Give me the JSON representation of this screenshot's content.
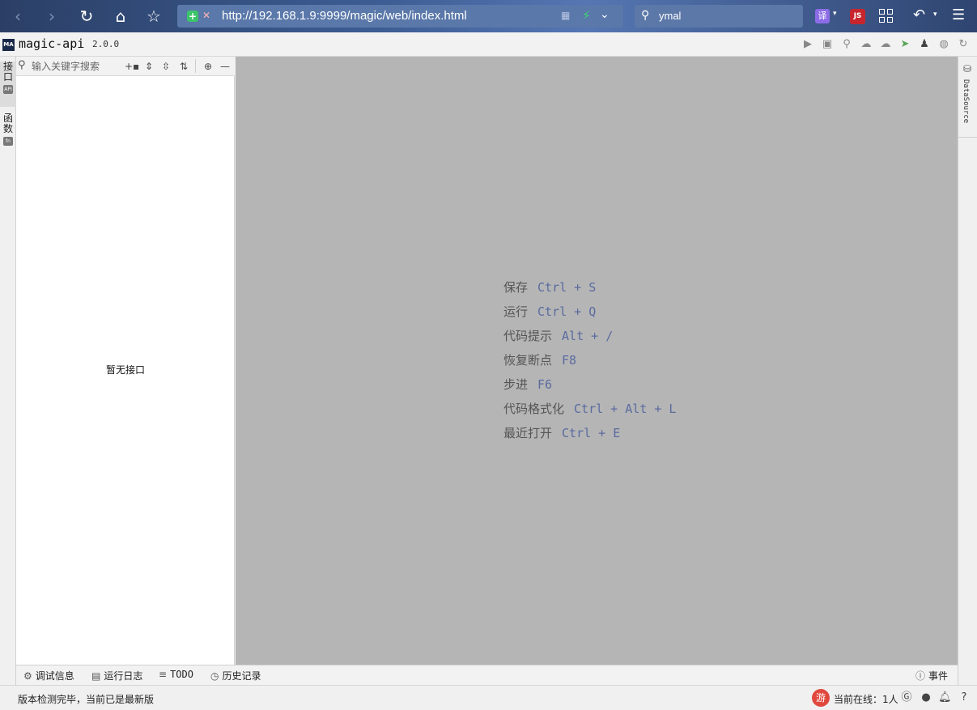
{
  "browser": {
    "url": "http://192.168.1.9:9999/magic/web/index.html",
    "search_text": "ymal",
    "translate_ext_label": "译",
    "js_ext_label": "JS"
  },
  "app": {
    "logo_text": "MA",
    "name": "magic-api",
    "version": "2.0.0"
  },
  "left_tabs": [
    {
      "label": "接口",
      "badge": "API"
    },
    {
      "label": "函数",
      "badge": "fn"
    }
  ],
  "sidebar": {
    "search_placeholder": "输入关键字搜索",
    "empty_text": "暂无接口"
  },
  "shortcuts": [
    {
      "label": "保存",
      "keys": "Ctrl + S"
    },
    {
      "label": "运行",
      "keys": "Ctrl + Q"
    },
    {
      "label": "代码提示",
      "keys": "Alt + /"
    },
    {
      "label": "恢复断点",
      "keys": "F8"
    },
    {
      "label": "步进",
      "keys": "F6"
    },
    {
      "label": "代码格式化",
      "keys": "Ctrl + Alt + L"
    },
    {
      "label": "最近打开",
      "keys": "Ctrl + E"
    }
  ],
  "right_tabs": {
    "datasource_label": "DataSource"
  },
  "bottom_tabs": [
    {
      "label": "调试信息"
    },
    {
      "label": "运行日志"
    },
    {
      "label": "TODO"
    },
    {
      "label": "历史记录"
    }
  ],
  "events_label": "事件",
  "status": {
    "message": "版本检测完毕，当前已是最新版",
    "you_badge": "游",
    "online_label": "当前在线：1人"
  }
}
